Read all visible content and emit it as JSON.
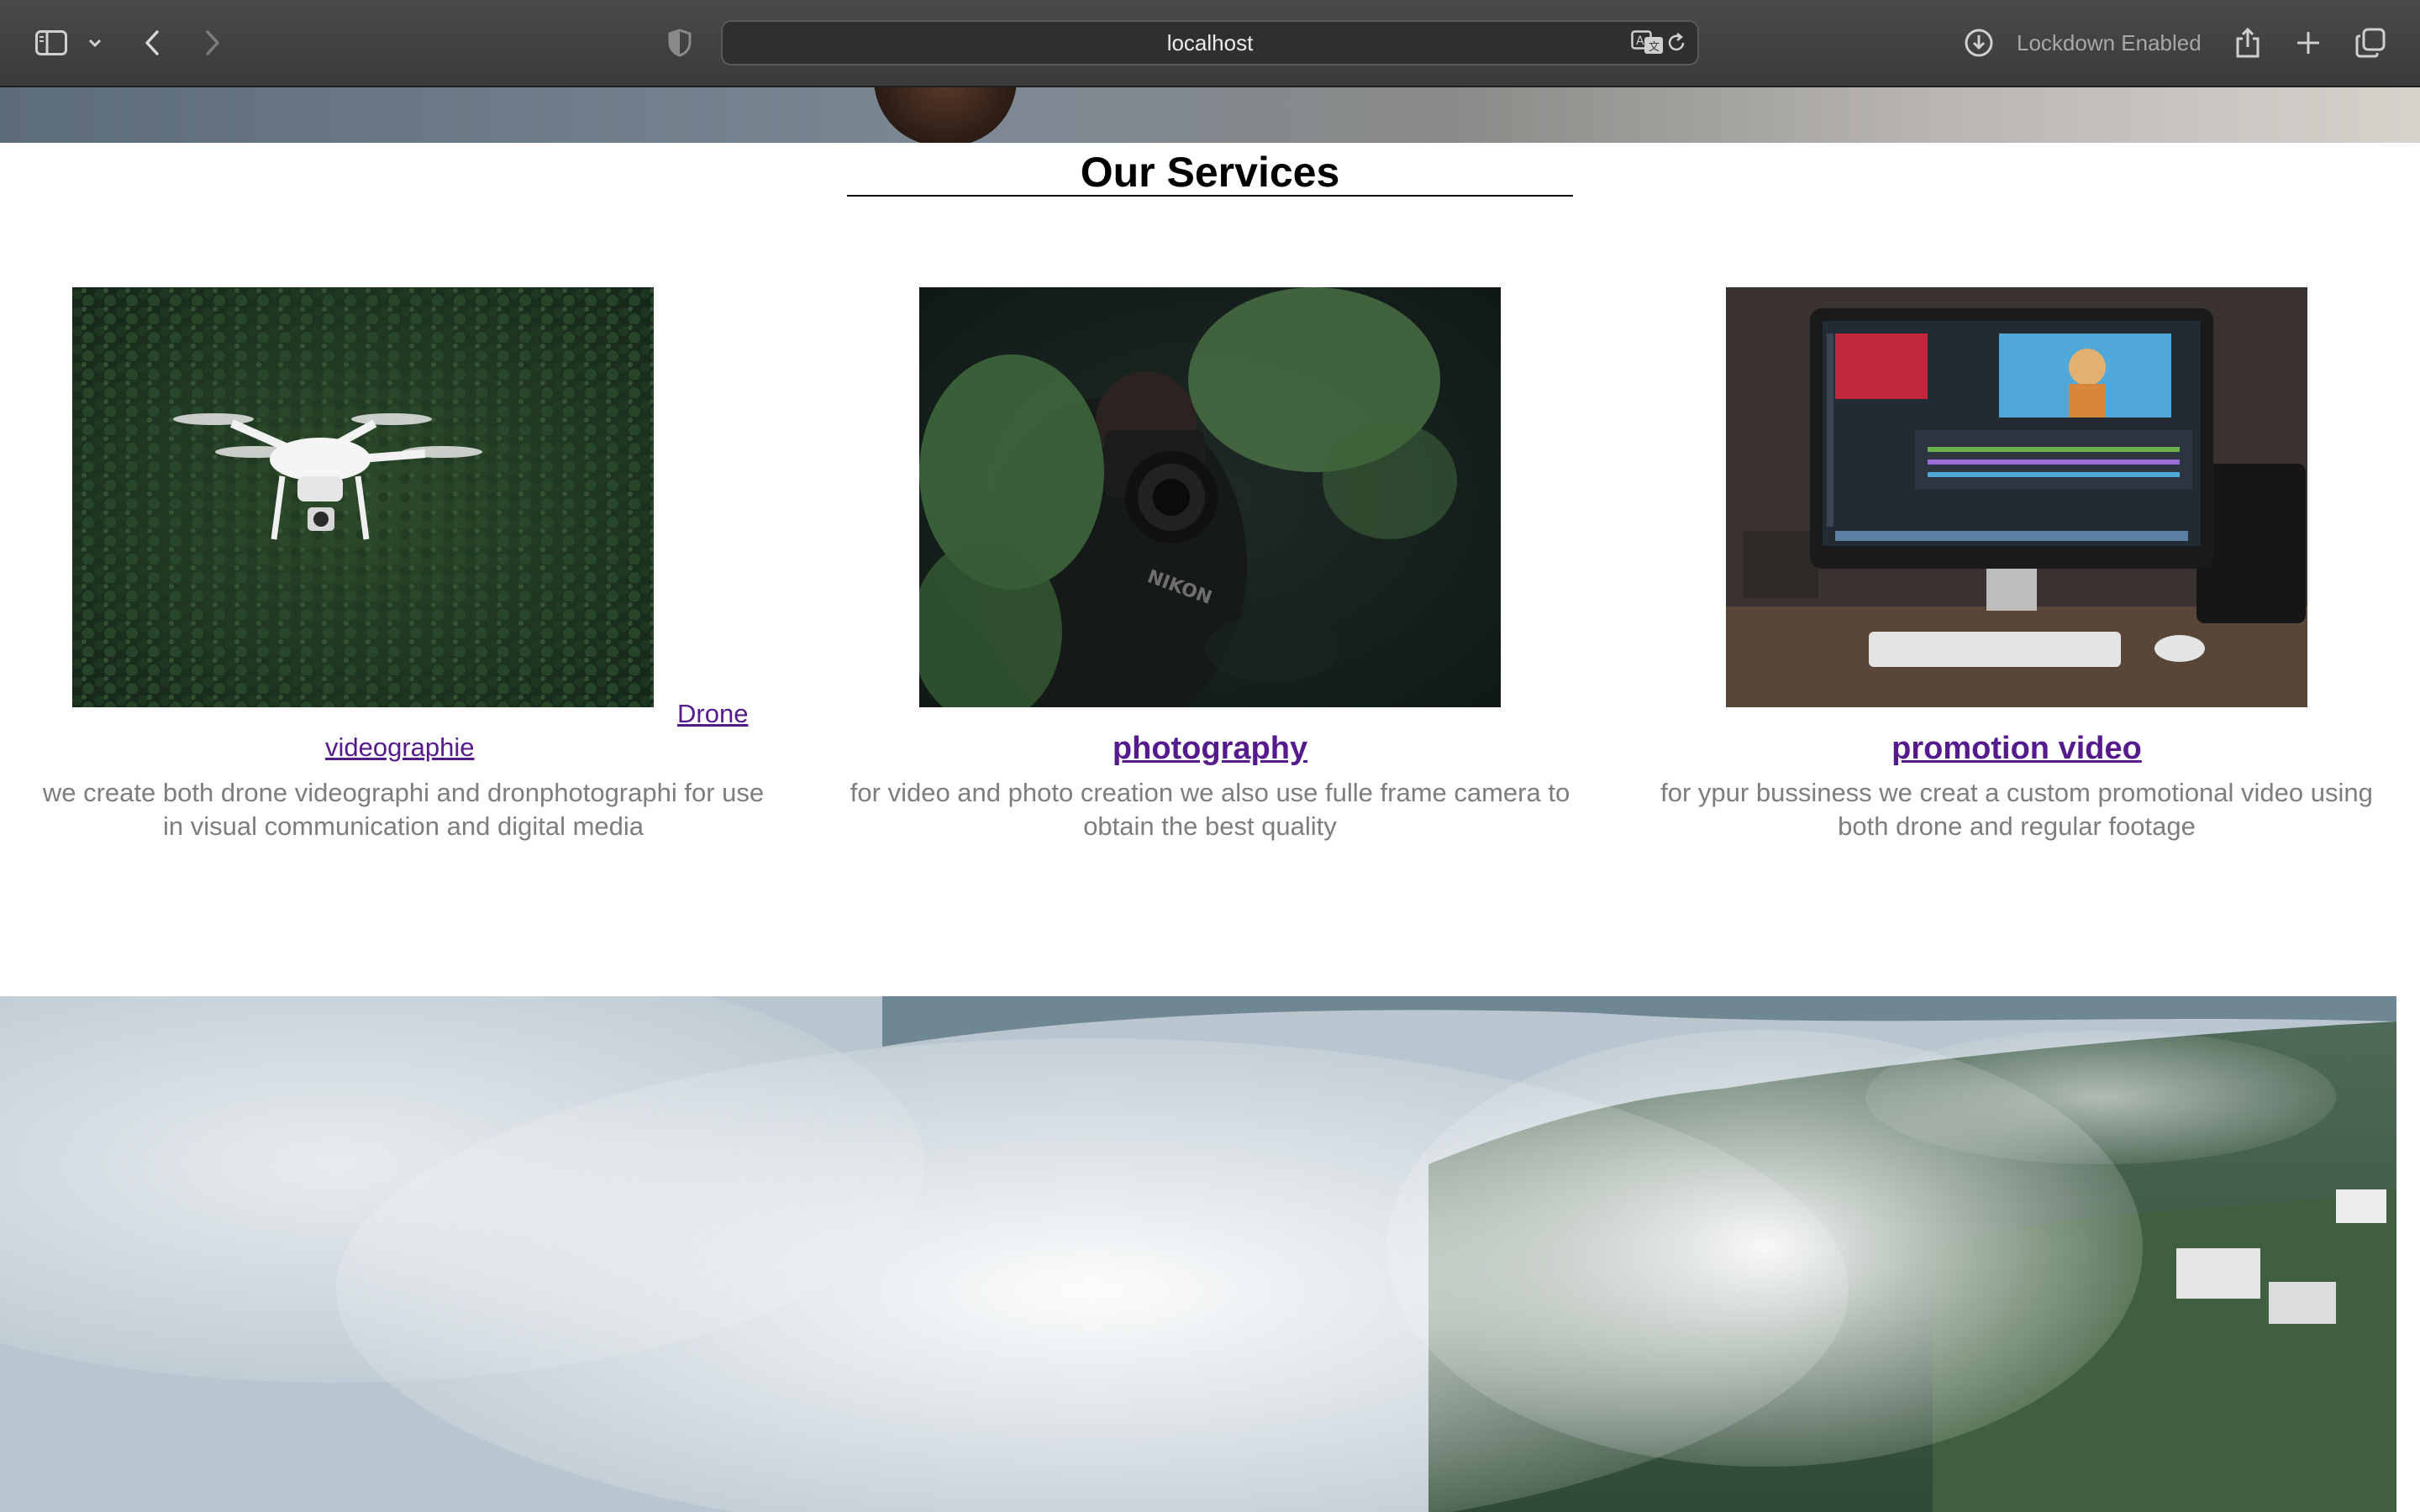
{
  "browser": {
    "url": "localhost",
    "lockdown_label": "Lockdown Enabled",
    "icons": {
      "sidebar": "sidebar-icon",
      "sidebar_menu": "chevron-down-icon",
      "back": "chevron-left-icon",
      "forward": "chevron-right-icon",
      "privacy": "shield-icon",
      "translate": "translate-icon",
      "reload": "reload-icon",
      "downloads": "download-icon",
      "share": "share-icon",
      "new_tab": "plus-icon",
      "tab_overview": "tabs-icon"
    }
  },
  "services": {
    "title": "Our Services",
    "items": [
      {
        "title_part1": "Drone",
        "title_part2": "videographie",
        "description": "we create both drone videographi and dronphotographi for use in visual communication and digital media",
        "image": "drone-photo"
      },
      {
        "title": "photography",
        "description": "for video and photo creation we also use fulle frame camera to obtain the best quality",
        "image": "photographer-photo"
      },
      {
        "title": "promotion video",
        "description": "for ypur bussiness we creat a custom promotional video using both drone and regular footage",
        "image": "video-editing-photo"
      }
    ]
  },
  "colors": {
    "link_visited": "#551a8b",
    "description_text": "#7d7d7d",
    "chrome_bg": "#3f3f41"
  }
}
